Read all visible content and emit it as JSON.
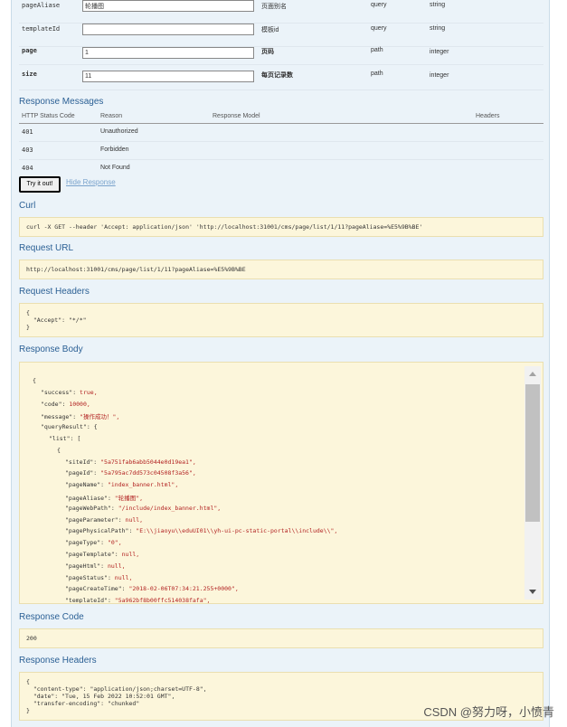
{
  "params": [
    {
      "name": "pageAliase",
      "value": "轮播图",
      "description": "页面别名",
      "param_type": "query",
      "data_type": "string",
      "bold": false
    },
    {
      "name": "templateId",
      "value": "",
      "description": "模板id",
      "param_type": "query",
      "data_type": "string",
      "bold": false
    },
    {
      "name": "page",
      "value": "1",
      "description": "页码",
      "param_type": "path",
      "data_type": "integer",
      "bold": true
    },
    {
      "name": "size",
      "value": "11",
      "description": "每页记录数",
      "param_type": "path",
      "data_type": "integer",
      "bold": true
    }
  ],
  "response_messages": {
    "title": "Response Messages",
    "headers": {
      "status": "HTTP Status Code",
      "reason": "Reason",
      "model": "Response Model",
      "headers": "Headers"
    },
    "rows": [
      {
        "code": "401",
        "reason": "Unauthorized"
      },
      {
        "code": "403",
        "reason": "Forbidden"
      },
      {
        "code": "404",
        "reason": "Not Found"
      }
    ]
  },
  "buttons": {
    "try_it_out": "Try it out!",
    "hide_response": "Hide Response"
  },
  "curl": {
    "title": "Curl",
    "command": "curl -X GET --header 'Accept: application/json' 'http://localhost:31001/cms/page/list/1/11?pageAliase=%E5%9B%BE'"
  },
  "request_url": {
    "title": "Request URL",
    "url": "http://localhost:31001/cms/page/list/1/11?pageAliase=%E5%9B%BE"
  },
  "request_headers": {
    "title": "Request Headers",
    "lines": [
      "{",
      "  \"Accept\": \"*/*\"",
      "}"
    ]
  },
  "response_body": {
    "title": "Response Body",
    "lines": [
      {
        "indent": 0,
        "key": "",
        "value": "{"
      },
      {
        "indent": 1,
        "key": "\"success\": ",
        "value": "true,"
      },
      {
        "indent": 1,
        "key": "\"code\": ",
        "value": "10000,"
      },
      {
        "indent": 1,
        "key": "\"message\": ",
        "value": "\"操作成功！\","
      },
      {
        "indent": 1,
        "key": "\"queryResult\": ",
        "value": "{"
      },
      {
        "indent": 2,
        "key": "\"list\": ",
        "value": "["
      },
      {
        "indent": 3,
        "key": "",
        "value": "{"
      },
      {
        "indent": 4,
        "key": "\"siteId\": ",
        "value": "\"5a751fab6abb5044e0d19ea1\","
      },
      {
        "indent": 4,
        "key": "\"pageId\": ",
        "value": "\"5a795ac7dd573c04508f3a56\","
      },
      {
        "indent": 4,
        "key": "\"pageName\": ",
        "value": "\"index_banner.html\","
      },
      {
        "indent": 4,
        "key": "\"pageAliase\": ",
        "value": "\"轮播图\","
      },
      {
        "indent": 4,
        "key": "\"pageWebPath\": ",
        "value": "\"/include/index_banner.html\","
      },
      {
        "indent": 4,
        "key": "\"pageParameter\": ",
        "value": "null,"
      },
      {
        "indent": 4,
        "key": "\"pagePhysicalPath\": ",
        "value": "\"E:\\\\jiaoyu\\\\eduUI01\\\\yh-ui-pc-static-portal\\\\include\\\\\","
      },
      {
        "indent": 4,
        "key": "\"pageType\": ",
        "value": "\"0\","
      },
      {
        "indent": 4,
        "key": "\"pageTemplate\": ",
        "value": "null,"
      },
      {
        "indent": 4,
        "key": "\"pageHtml\": ",
        "value": "null,"
      },
      {
        "indent": 4,
        "key": "\"pageStatus\": ",
        "value": "null,"
      },
      {
        "indent": 4,
        "key": "\"pageCreateTime\": ",
        "value": "\"2018-02-06T07:34:21.255+0000\","
      },
      {
        "indent": 4,
        "key": "\"templateId\": ",
        "value": "\"5a962bf8b00ffc514038fafa\","
      }
    ]
  },
  "response_code": {
    "title": "Response Code",
    "value": "200"
  },
  "response_headers": {
    "title": "Response Headers",
    "lines": [
      "{",
      "  \"content-type\": \"application/json;charset=UTF-8\",",
      "  \"date\": \"Tue, 15 Feb 2022 10:52:01 GMT\",",
      "  \"transfer-encoding\": \"chunked\"",
      "}"
    ]
  },
  "watermark": "CSDN @努力呀，小愤青",
  "colors": {
    "panel": "#ebf3f9",
    "section_title": "#2a5f94",
    "code_bg": "#fcf6db",
    "link": "#7aa3cc"
  }
}
